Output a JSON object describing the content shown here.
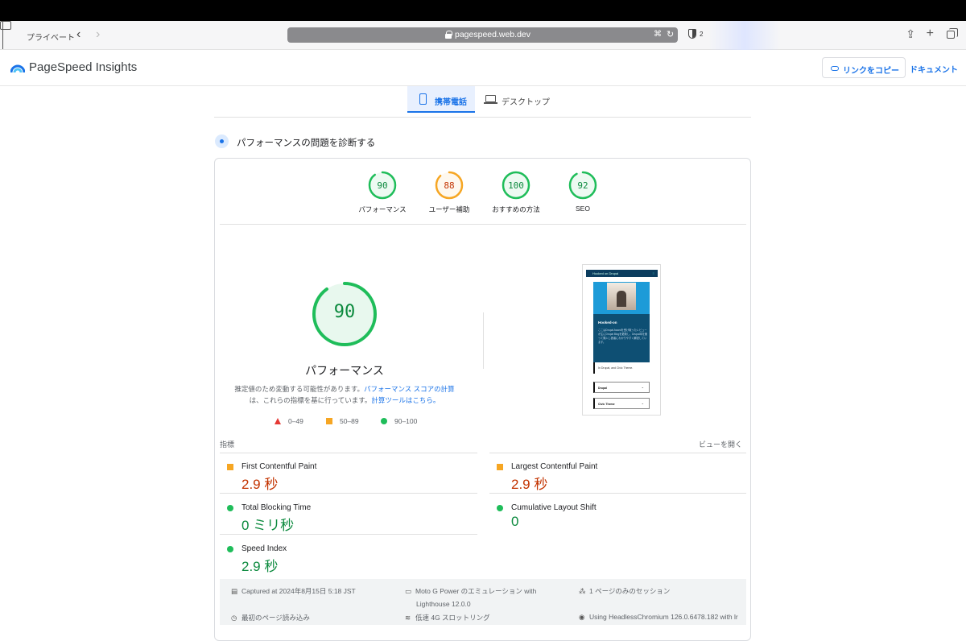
{
  "browser": {
    "private_label": "プライベート",
    "url": "pagespeed.web.dev",
    "tab_count": "2"
  },
  "app": {
    "title": "PageSpeed Insights",
    "copy_link": "リンクをコピー",
    "docs": "ドキュメント"
  },
  "device_tabs": {
    "mobile": "携帯電話",
    "desktop": "デスクトップ"
  },
  "diagnose_title": "パフォーマンスの問題を診断する",
  "categories": [
    {
      "label": "パフォーマンス",
      "score": "90",
      "color": "#1fbd5a",
      "text_color": "#0c8a3e",
      "fraction": 0.9
    },
    {
      "label": "ユーザー補助",
      "score": "88",
      "color": "#f6a623",
      "text_color": "#c33300",
      "fraction": 0.88
    },
    {
      "label": "おすすめの方法",
      "score": "100",
      "color": "#1fbd5a",
      "text_color": "#0c8a3e",
      "fraction": 1.0
    },
    {
      "label": "SEO",
      "score": "92",
      "color": "#1fbd5a",
      "text_color": "#0c8a3e",
      "fraction": 0.92
    }
  ],
  "main_score": {
    "value": "90",
    "label": "パフォーマンス",
    "fraction": 0.9
  },
  "note": {
    "text1": "推定値のため変動する可能性があります。",
    "link1": "パフォーマンス スコアの計算",
    "text2": "は、これらの指標を基に行っています。",
    "link2": "計算ツールはこちら。"
  },
  "legend": [
    "0–49",
    "50–89",
    "90–100"
  ],
  "screenshot": {
    "header": "Hooked on Drupal",
    "menu": "≡",
    "heading": "Hooked-on",
    "paragraph": "ここはDrupal Awardを受け取ったレビューが主にDrupal Blogを更新し、Drupal本を使って購入し読者にわかりやすく解説しています。",
    "quote": "In Drupal, and Civic Theme.",
    "select1": "Drupal",
    "select2": "Civic Theme"
  },
  "metrics_heading": "指標",
  "expand_label": "ビューを開く",
  "metrics": [
    {
      "name": "First Contentful Paint",
      "value": "2.9 秒",
      "status": "orange"
    },
    {
      "name": "Largest Contentful Paint",
      "value": "2.9 秒",
      "status": "orange"
    },
    {
      "name": "Total Blocking Time",
      "value": "0 ミリ秒",
      "status": "green"
    },
    {
      "name": "Cumulative Layout Shift",
      "value": "0",
      "status": "green"
    },
    {
      "name": "Speed Index",
      "value": "2.9 秒",
      "status": "green"
    }
  ],
  "footer": {
    "captured": "Captured at 2024年8月15日 5:18 JST",
    "device": "Moto G Power のエミュレーション with",
    "lighthouse": "Lighthouse 12.0.0",
    "session": "1 ページのみのセッション",
    "initial_load": "最初のページ読み込み",
    "throttling": "低速 4G スロットリング",
    "browser": "Using HeadlessChromium 126.0.6478.182 with lr"
  },
  "colors": {
    "accent": "#1a73e8",
    "pass": "#1fbd5a",
    "average": "#f6a623",
    "fail": "#e53935"
  }
}
